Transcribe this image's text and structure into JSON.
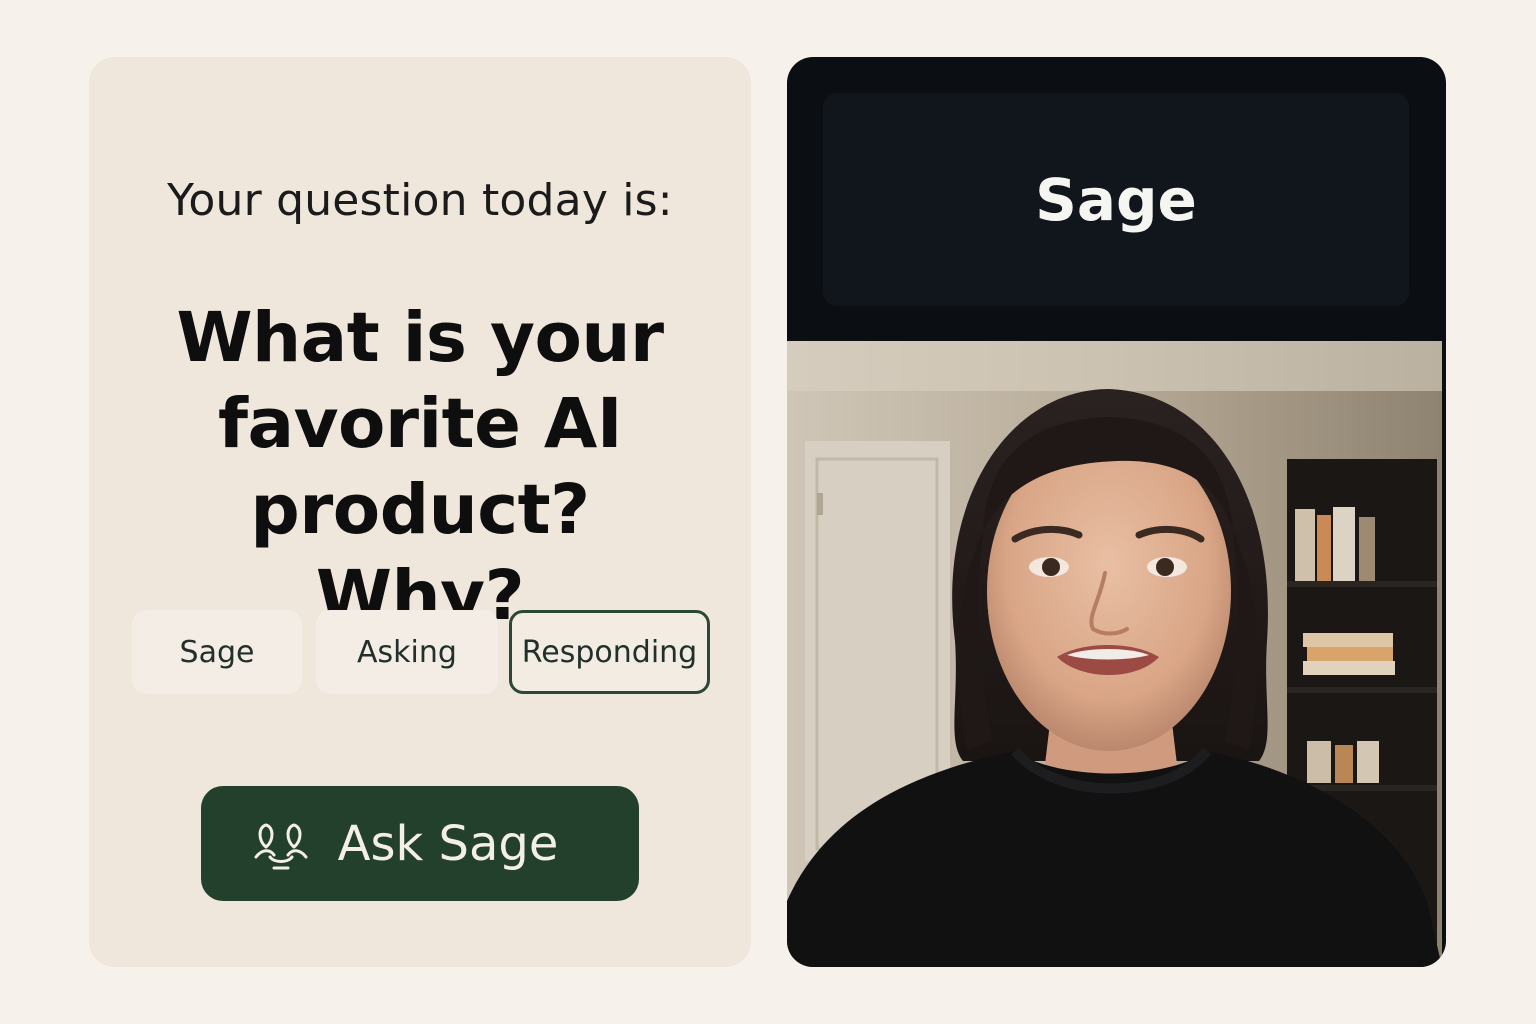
{
  "question_card": {
    "intro": "Your question today is:",
    "question": "What is your favorite AI product? Why?"
  },
  "status_tabs": [
    {
      "label": "Sage",
      "active": false
    },
    {
      "label": "Asking",
      "active": false
    },
    {
      "label": "Responding",
      "active": true
    }
  ],
  "ask_button": {
    "label": "Ask Sage",
    "icon": "people-icon"
  },
  "video_card": {
    "speaker_name": "Sage",
    "feed": "speaker-video-feed"
  },
  "colors": {
    "page_background": "#f6f1ea",
    "card_background": "#efe6dc",
    "accent_green": "#23402c",
    "video_background": "#0b0f13"
  }
}
